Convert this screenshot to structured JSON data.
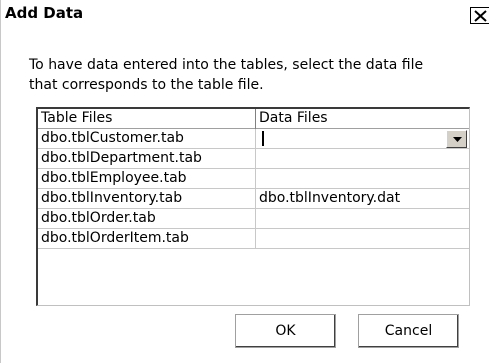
{
  "dialog": {
    "title": "Add Data",
    "close_icon": "close-icon",
    "instructions": "To have data entered into the tables, select the data file that corresponds to the table file."
  },
  "grid": {
    "columns": [
      "Table Files",
      "Data Files"
    ],
    "rows": [
      {
        "table_file": "dbo.tblCustomer.tab",
        "data_file": ""
      },
      {
        "table_file": "dbo.tblDepartment.tab",
        "data_file": ""
      },
      {
        "table_file": "dbo.tblEmployee.tab",
        "data_file": ""
      },
      {
        "table_file": "dbo.tblInventory.tab",
        "data_file": "dbo.tblInventory.dat"
      },
      {
        "table_file": "dbo.tblOrder.tab",
        "data_file": ""
      },
      {
        "table_file": "dbo.tblOrderItem.tab",
        "data_file": ""
      }
    ],
    "dropdown_icon": "chevron-down-icon"
  },
  "buttons": {
    "ok": "OK",
    "cancel": "Cancel"
  }
}
